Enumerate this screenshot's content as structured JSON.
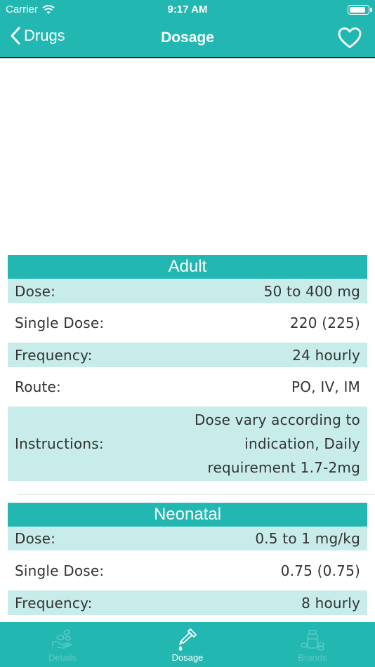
{
  "status_bar": {
    "carrier": "Carrier",
    "time": "9:17 AM",
    "battery_level": 0.9
  },
  "nav": {
    "back_label": "Drugs",
    "title": "Dosage"
  },
  "adult": {
    "title": "Adult",
    "rows": [
      {
        "label": "Dose:",
        "value": "50 to 400 mg"
      },
      {
        "label": "Single Dose:",
        "value": "220 (225)"
      },
      {
        "label": "Frequency:",
        "value": "24 hourly"
      },
      {
        "label": "Route:",
        "value": "PO, IV, IM"
      },
      {
        "label": "Instructions:",
        "value_lines": [
          "Dose vary according to",
          "indication, Daily",
          "requirement 1.7-2mg"
        ]
      }
    ]
  },
  "neonatal": {
    "title": "Neonatal",
    "rows": [
      {
        "label": "Dose:",
        "value": "0.5 to 1 mg/kg"
      },
      {
        "label": "Single Dose:",
        "value": "0.75 (0.75)"
      },
      {
        "label": "Frequency:",
        "value": "8 hourly"
      }
    ]
  },
  "tabs": [
    {
      "label": "Details",
      "icon": "hand-pills-icon",
      "active": false
    },
    {
      "label": "Dosage",
      "icon": "dropper-icon",
      "active": true
    },
    {
      "label": "Brands",
      "icon": "pills-bottle-icon",
      "active": false
    }
  ],
  "colors": {
    "accent": "#22b7b1",
    "row_shade": "#c8ecea",
    "inactive_tab": "#5ac9c2"
  }
}
